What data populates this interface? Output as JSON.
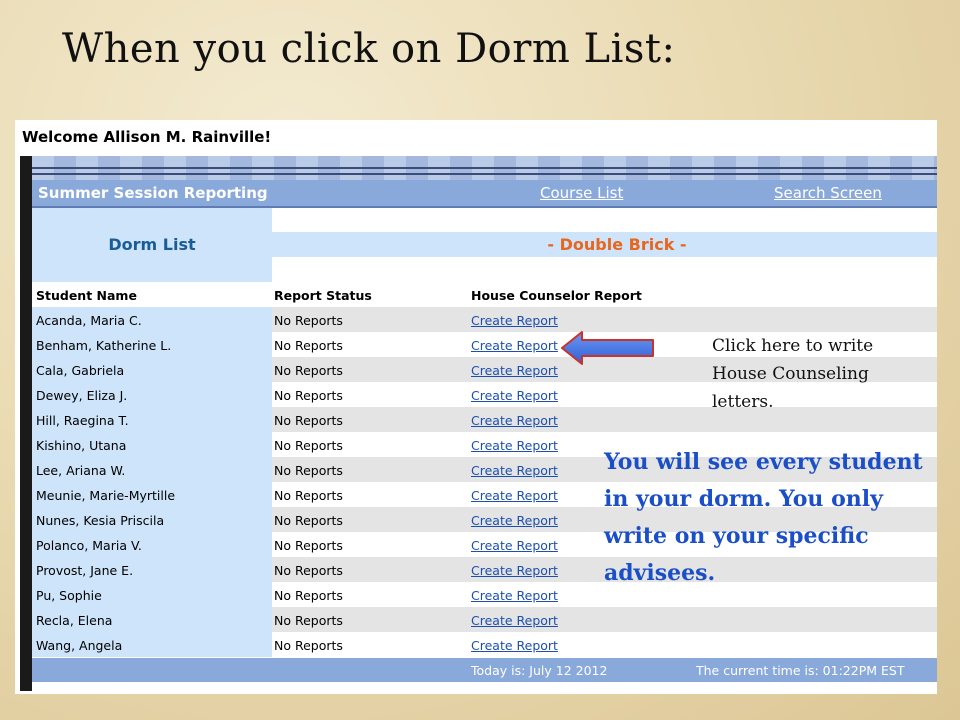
{
  "slide": {
    "title": "When you click on Dorm List:",
    "callout": "Click here to write House Counseling letters.",
    "emphasis": "You will see every student in your dorm. You only write on your specific advisees."
  },
  "app": {
    "welcome": "Welcome Allison M. Rainville!",
    "nav": {
      "title": "Summer Session Reporting",
      "course_list": "Course List",
      "search_screen": "Search Screen"
    },
    "dorm_list_label": "Dorm List",
    "dorm_name": "- Double Brick -",
    "columns": [
      "Student Name",
      "Report Status",
      "House Counselor Report"
    ],
    "rows": [
      {
        "name": "Acanda, Maria C.",
        "status": "No Reports",
        "action": "Create Report"
      },
      {
        "name": "Benham, Katherine L.",
        "status": "No Reports",
        "action": "Create Report"
      },
      {
        "name": "Cala, Gabriela",
        "status": "No Reports",
        "action": "Create Report"
      },
      {
        "name": "Dewey, Eliza J.",
        "status": "No Reports",
        "action": "Create Report"
      },
      {
        "name": "Hill, Raegina T.",
        "status": "No Reports",
        "action": "Create Report"
      },
      {
        "name": "Kishino, Utana",
        "status": "No Reports",
        "action": "Create Report"
      },
      {
        "name": "Lee, Ariana W.",
        "status": "No Reports",
        "action": "Create Report"
      },
      {
        "name": "Meunie, Marie-Myrtille",
        "status": "No Reports",
        "action": "Create Report"
      },
      {
        "name": "Nunes, Kesia Priscila",
        "status": "No Reports",
        "action": "Create Report"
      },
      {
        "name": "Polanco, Maria V.",
        "status": "No Reports",
        "action": "Create Report"
      },
      {
        "name": "Provost, Jane E.",
        "status": "No Reports",
        "action": "Create Report"
      },
      {
        "name": "Pu, Sophie",
        "status": "No Reports",
        "action": "Create Report"
      },
      {
        "name": "Recla, Elena",
        "status": "No Reports",
        "action": "Create Report"
      },
      {
        "name": "Wang, Angela",
        "status": "No Reports",
        "action": "Create Report"
      }
    ],
    "footer": {
      "date": "Today is: July 12 2012",
      "time": "The current time is: 01:22PM EST"
    }
  },
  "colors": {
    "nav_blue": "#8aa9db",
    "panel_blue": "#cde4fb",
    "dorm_label": "#1a5c97",
    "dorm_name": "#e8661d",
    "link": "#1d4fb0",
    "emphasis_text": "#1b4fc7",
    "arrow": "#3f6fe0"
  },
  "icons": {
    "arrow": "left-arrow-icon"
  }
}
